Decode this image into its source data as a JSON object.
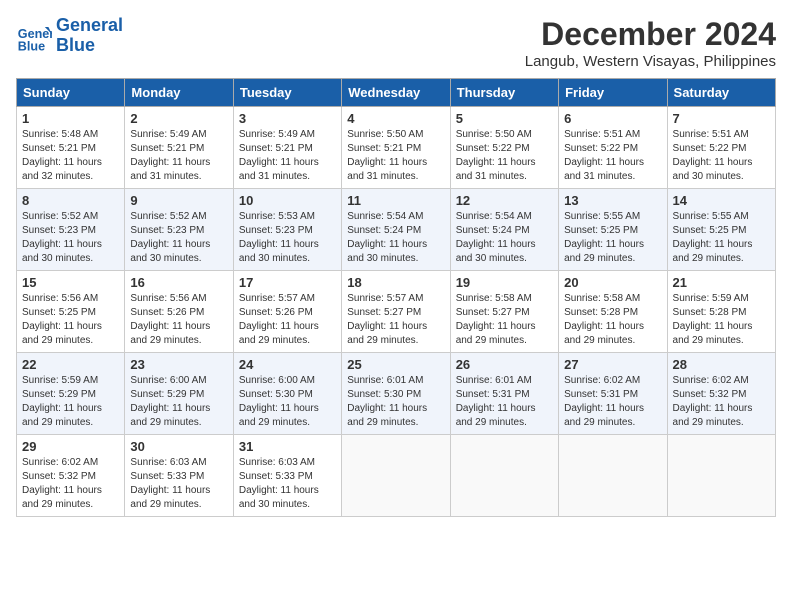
{
  "header": {
    "logo_line1": "General",
    "logo_line2": "Blue",
    "title": "December 2024",
    "subtitle": "Langub, Western Visayas, Philippines"
  },
  "weekdays": [
    "Sunday",
    "Monday",
    "Tuesday",
    "Wednesday",
    "Thursday",
    "Friday",
    "Saturday"
  ],
  "weeks": [
    [
      {
        "day": "1",
        "sunrise": "5:48 AM",
        "sunset": "5:21 PM",
        "daylight": "11 hours and 32 minutes."
      },
      {
        "day": "2",
        "sunrise": "5:49 AM",
        "sunset": "5:21 PM",
        "daylight": "11 hours and 31 minutes."
      },
      {
        "day": "3",
        "sunrise": "5:49 AM",
        "sunset": "5:21 PM",
        "daylight": "11 hours and 31 minutes."
      },
      {
        "day": "4",
        "sunrise": "5:50 AM",
        "sunset": "5:21 PM",
        "daylight": "11 hours and 31 minutes."
      },
      {
        "day": "5",
        "sunrise": "5:50 AM",
        "sunset": "5:22 PM",
        "daylight": "11 hours and 31 minutes."
      },
      {
        "day": "6",
        "sunrise": "5:51 AM",
        "sunset": "5:22 PM",
        "daylight": "11 hours and 31 minutes."
      },
      {
        "day": "7",
        "sunrise": "5:51 AM",
        "sunset": "5:22 PM",
        "daylight": "11 hours and 30 minutes."
      }
    ],
    [
      {
        "day": "8",
        "sunrise": "5:52 AM",
        "sunset": "5:23 PM",
        "daylight": "11 hours and 30 minutes."
      },
      {
        "day": "9",
        "sunrise": "5:52 AM",
        "sunset": "5:23 PM",
        "daylight": "11 hours and 30 minutes."
      },
      {
        "day": "10",
        "sunrise": "5:53 AM",
        "sunset": "5:23 PM",
        "daylight": "11 hours and 30 minutes."
      },
      {
        "day": "11",
        "sunrise": "5:54 AM",
        "sunset": "5:24 PM",
        "daylight": "11 hours and 30 minutes."
      },
      {
        "day": "12",
        "sunrise": "5:54 AM",
        "sunset": "5:24 PM",
        "daylight": "11 hours and 30 minutes."
      },
      {
        "day": "13",
        "sunrise": "5:55 AM",
        "sunset": "5:25 PM",
        "daylight": "11 hours and 29 minutes."
      },
      {
        "day": "14",
        "sunrise": "5:55 AM",
        "sunset": "5:25 PM",
        "daylight": "11 hours and 29 minutes."
      }
    ],
    [
      {
        "day": "15",
        "sunrise": "5:56 AM",
        "sunset": "5:25 PM",
        "daylight": "11 hours and 29 minutes."
      },
      {
        "day": "16",
        "sunrise": "5:56 AM",
        "sunset": "5:26 PM",
        "daylight": "11 hours and 29 minutes."
      },
      {
        "day": "17",
        "sunrise": "5:57 AM",
        "sunset": "5:26 PM",
        "daylight": "11 hours and 29 minutes."
      },
      {
        "day": "18",
        "sunrise": "5:57 AM",
        "sunset": "5:27 PM",
        "daylight": "11 hours and 29 minutes."
      },
      {
        "day": "19",
        "sunrise": "5:58 AM",
        "sunset": "5:27 PM",
        "daylight": "11 hours and 29 minutes."
      },
      {
        "day": "20",
        "sunrise": "5:58 AM",
        "sunset": "5:28 PM",
        "daylight": "11 hours and 29 minutes."
      },
      {
        "day": "21",
        "sunrise": "5:59 AM",
        "sunset": "5:28 PM",
        "daylight": "11 hours and 29 minutes."
      }
    ],
    [
      {
        "day": "22",
        "sunrise": "5:59 AM",
        "sunset": "5:29 PM",
        "daylight": "11 hours and 29 minutes."
      },
      {
        "day": "23",
        "sunrise": "6:00 AM",
        "sunset": "5:29 PM",
        "daylight": "11 hours and 29 minutes."
      },
      {
        "day": "24",
        "sunrise": "6:00 AM",
        "sunset": "5:30 PM",
        "daylight": "11 hours and 29 minutes."
      },
      {
        "day": "25",
        "sunrise": "6:01 AM",
        "sunset": "5:30 PM",
        "daylight": "11 hours and 29 minutes."
      },
      {
        "day": "26",
        "sunrise": "6:01 AM",
        "sunset": "5:31 PM",
        "daylight": "11 hours and 29 minutes."
      },
      {
        "day": "27",
        "sunrise": "6:02 AM",
        "sunset": "5:31 PM",
        "daylight": "11 hours and 29 minutes."
      },
      {
        "day": "28",
        "sunrise": "6:02 AM",
        "sunset": "5:32 PM",
        "daylight": "11 hours and 29 minutes."
      }
    ],
    [
      {
        "day": "29",
        "sunrise": "6:02 AM",
        "sunset": "5:32 PM",
        "daylight": "11 hours and 29 minutes."
      },
      {
        "day": "30",
        "sunrise": "6:03 AM",
        "sunset": "5:33 PM",
        "daylight": "11 hours and 29 minutes."
      },
      {
        "day": "31",
        "sunrise": "6:03 AM",
        "sunset": "5:33 PM",
        "daylight": "11 hours and 30 minutes."
      },
      null,
      null,
      null,
      null
    ]
  ]
}
